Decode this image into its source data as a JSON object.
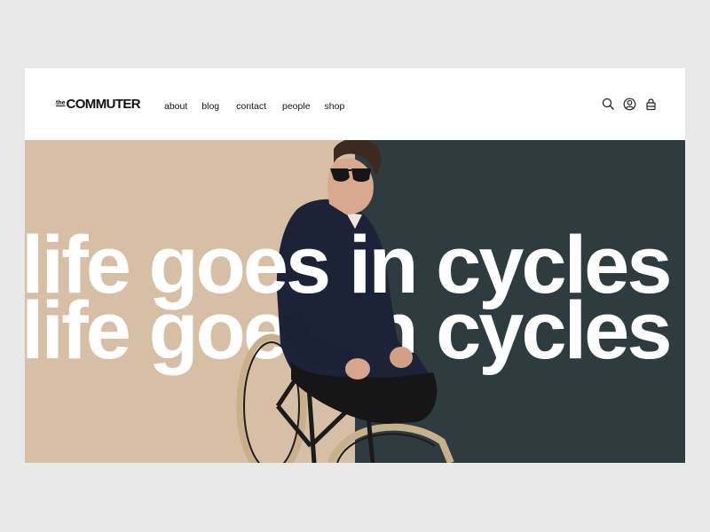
{
  "header": {
    "logo_prefix": "the",
    "logo_name": "COMMUTER",
    "nav": [
      {
        "label": "about"
      },
      {
        "label": "blog"
      },
      {
        "label": "contact"
      },
      {
        "label": "people"
      },
      {
        "label": "shop"
      }
    ],
    "icons": [
      "search-icon",
      "account-icon",
      "bag-icon"
    ]
  },
  "hero": {
    "headline_line1": "life goes in cycles",
    "headline_line2": "life goes in cycles",
    "image": "man-with-sunglasses-on-bicycle",
    "colors": {
      "left_panel": "#d6bfa5",
      "right_panel": "#2e3b3f",
      "text": "#ffffff"
    }
  }
}
